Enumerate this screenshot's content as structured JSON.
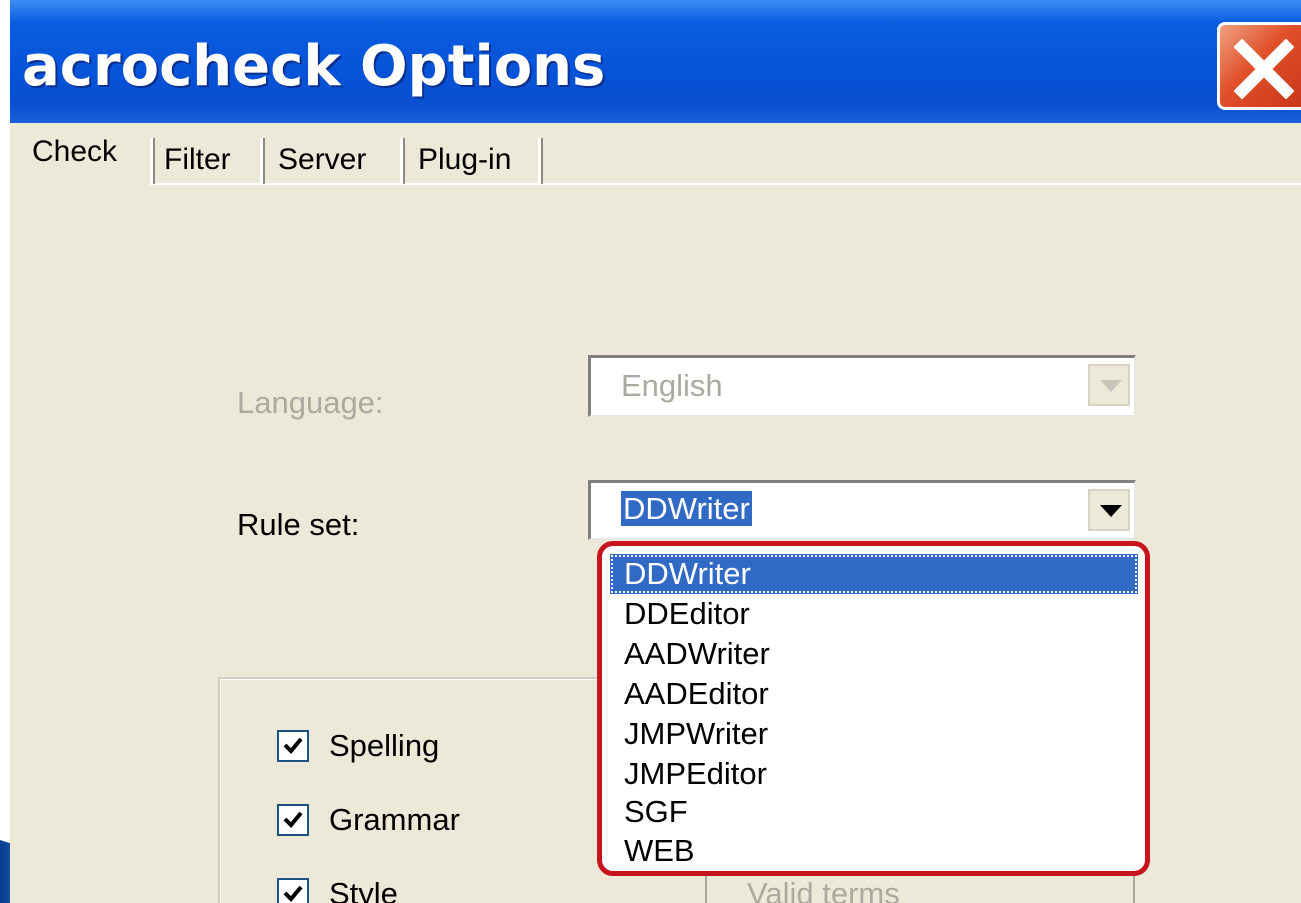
{
  "window": {
    "title": "acrocheck Options"
  },
  "tabs": [
    {
      "label": "Check",
      "active": true
    },
    {
      "label": "Filter",
      "active": false
    },
    {
      "label": "Server",
      "active": false
    },
    {
      "label": "Plug-in",
      "active": false
    }
  ],
  "form": {
    "language_label": "Language:",
    "language_value": "English",
    "ruleset_label": "Rule set:",
    "ruleset_value": "DDWriter"
  },
  "ruleset_options": [
    "DDWriter",
    "DDEditor",
    "AADWriter",
    "AADEditor",
    "JMPWriter",
    "JMPEditor",
    "SGF",
    "WEB"
  ],
  "checks": [
    {
      "label": "Spelling",
      "checked": true
    },
    {
      "label": "Grammar",
      "checked": true
    },
    {
      "label": "Style",
      "checked": true
    }
  ],
  "valid_terms_label": "Valid terms",
  "colors": {
    "title_bar": "#0652d8",
    "selection": "#316ac5",
    "highlight_border": "#c8141e",
    "dialog_bg": "#ece9d8"
  }
}
